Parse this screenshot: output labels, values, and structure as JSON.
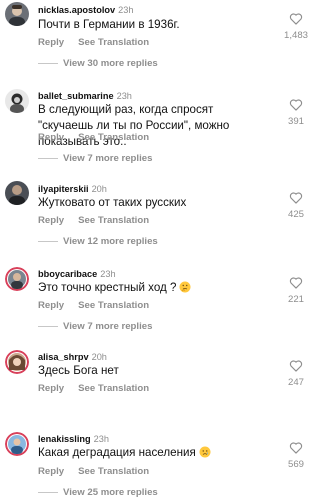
{
  "comments": [
    {
      "username": "nicklas.apostolov",
      "time": "23h",
      "text": "Почти в Германии в 1936г.",
      "reply_label": "Reply",
      "translate_label": "See Translation",
      "more_replies": "View 30 more replies",
      "like_count": "1,483",
      "avatar_icon": "profile-photo"
    },
    {
      "username": "ballet_submarine",
      "time": "23h",
      "text": "В следующий раз, когда спросят \"скучаешь ли ты по России\", можно показывать это..",
      "reply_label": "Reply",
      "translate_label": "See Translation",
      "more_replies": "View 7 more replies",
      "like_count": "391",
      "avatar_icon": "profile-photo"
    },
    {
      "username": "ilyapiterskii",
      "time": "20h",
      "text": "Жутковато от таких русских",
      "reply_label": "Reply",
      "translate_label": "See Translation",
      "more_replies": "View 12 more replies",
      "like_count": "425",
      "avatar_icon": "profile-photo"
    },
    {
      "username": "bboycaribace",
      "time": "23h",
      "text": "Это точно крестный ход ?",
      "emoji": "thinking-face",
      "reply_label": "Reply",
      "translate_label": "See Translation",
      "more_replies": "View 7 more replies",
      "like_count": "221",
      "avatar_icon": "profile-photo"
    },
    {
      "username": "alisa_shrpv",
      "time": "20h",
      "text": "Здесь Бога нет",
      "reply_label": "Reply",
      "translate_label": "See Translation",
      "like_count": "247",
      "avatar_icon": "profile-photo"
    },
    {
      "username": "lenakissling",
      "time": "23h",
      "text": "Какая деградация населения",
      "emoji": "sad-face",
      "reply_label": "Reply",
      "translate_label": "See Translation",
      "more_replies": "View 25 more replies",
      "like_count": "569",
      "avatar_icon": "profile-photo"
    }
  ],
  "colors": {
    "text_primary": "#111111",
    "text_secondary": "#8e8e8e",
    "divider_line": "#c7c7c7",
    "background": "#ffffff"
  }
}
